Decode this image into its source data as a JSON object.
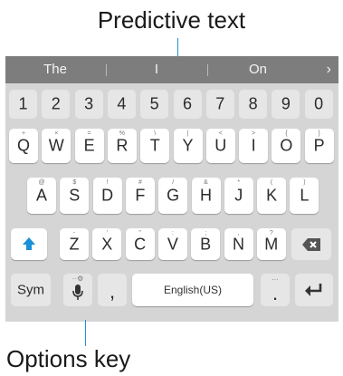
{
  "callouts": {
    "top": "Predictive text",
    "bottom": "Options key"
  },
  "suggestions": {
    "items": [
      "The",
      "I",
      "On"
    ],
    "more_glyph": "›"
  },
  "keyboard": {
    "number_row": [
      "1",
      "2",
      "3",
      "4",
      "5",
      "6",
      "7",
      "8",
      "9",
      "0"
    ],
    "row1": [
      {
        "key": "Q",
        "sub": "+"
      },
      {
        "key": "W",
        "sub": "×"
      },
      {
        "key": "E",
        "sub": "="
      },
      {
        "key": "R",
        "sub": "%"
      },
      {
        "key": "T",
        "sub": "\\"
      },
      {
        "key": "Y",
        "sub": "|"
      },
      {
        "key": "U",
        "sub": "<"
      },
      {
        "key": "I",
        "sub": ">"
      },
      {
        "key": "O",
        "sub": "{"
      },
      {
        "key": "P",
        "sub": "}"
      }
    ],
    "row2": [
      {
        "key": "A",
        "sub": "@"
      },
      {
        "key": "S",
        "sub": "$"
      },
      {
        "key": "D",
        "sub": "!"
      },
      {
        "key": "F",
        "sub": "#"
      },
      {
        "key": "G",
        "sub": "/"
      },
      {
        "key": "H",
        "sub": "&"
      },
      {
        "key": "J",
        "sub": "*"
      },
      {
        "key": "K",
        "sub": "("
      },
      {
        "key": "L",
        "sub": ")"
      }
    ],
    "row3": [
      {
        "key": "Z",
        "sub": "-"
      },
      {
        "key": "X",
        "sub": "'"
      },
      {
        "key": "C",
        "sub": "\""
      },
      {
        "key": "V",
        "sub": ":"
      },
      {
        "key": "B",
        "sub": ";"
      },
      {
        "key": "N",
        "sub": ","
      },
      {
        "key": "M",
        "sub": "?"
      }
    ],
    "shift_icon": "shift-icon",
    "backspace_icon": "backspace-icon",
    "sym_label": "Sym",
    "mic_icon": "microphone-icon",
    "comma": ",",
    "space_label": "English(US)",
    "period": ".",
    "period_sub": "···",
    "enter_icon": "enter-icon",
    "accent_color": "#1a90d8"
  }
}
